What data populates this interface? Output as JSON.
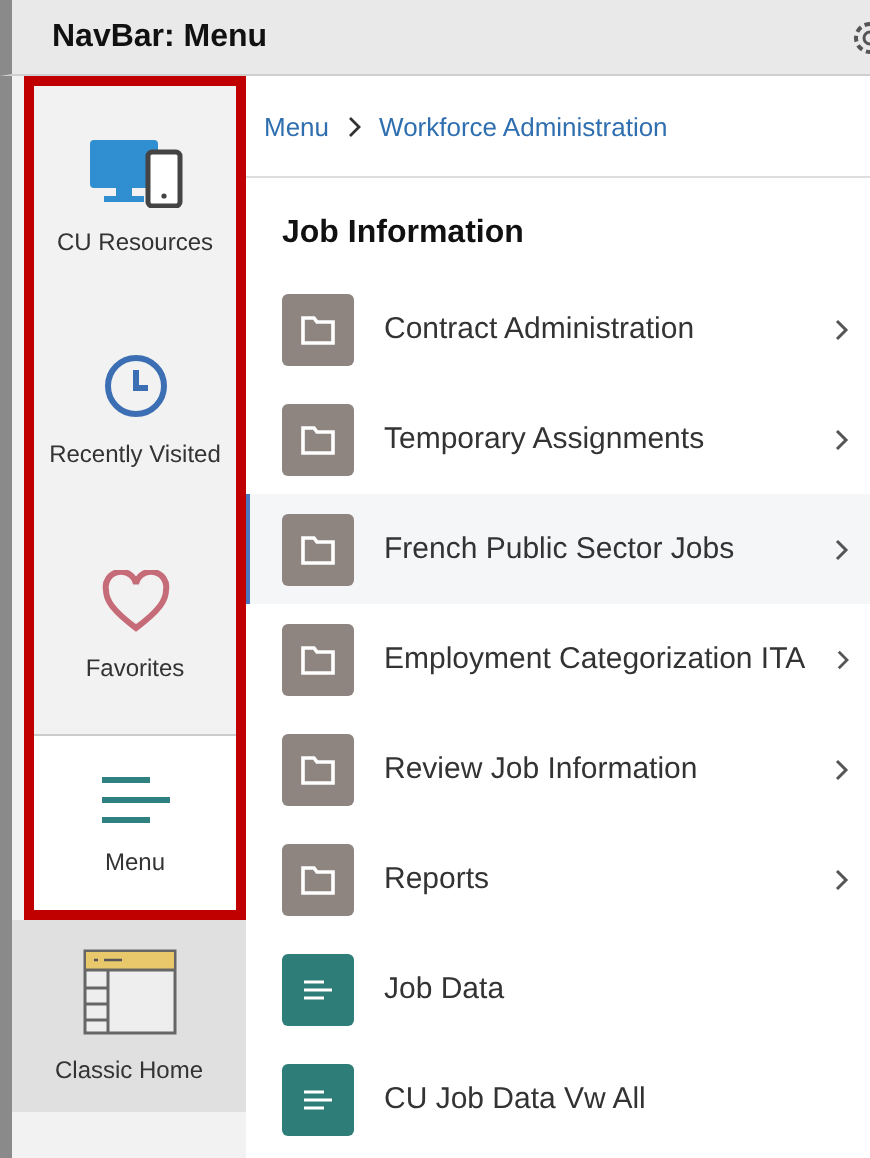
{
  "header": {
    "title": "NavBar: Menu"
  },
  "sidebar": {
    "items": [
      {
        "label": "CU Resources",
        "selected": false,
        "highlighted": true
      },
      {
        "label": "Recently Visited",
        "selected": false,
        "highlighted": true
      },
      {
        "label": "Favorites",
        "selected": false,
        "highlighted": true
      },
      {
        "label": "Menu",
        "selected": true,
        "highlighted": true
      },
      {
        "label": "Classic Home",
        "selected": false,
        "highlighted": false
      }
    ]
  },
  "breadcrumb": [
    "Menu",
    "Workforce Administration"
  ],
  "section": {
    "title": "Job Information"
  },
  "rows": [
    {
      "label": "Contract Administration",
      "kind": "folder",
      "hovered": false
    },
    {
      "label": "Temporary Assignments",
      "kind": "folder",
      "hovered": false
    },
    {
      "label": "French Public Sector Jobs",
      "kind": "folder",
      "hovered": true
    },
    {
      "label": "Employment Categorization ITA",
      "kind": "folder",
      "hovered": false
    },
    {
      "label": "Review Job Information",
      "kind": "folder",
      "hovered": false
    },
    {
      "label": "Reports",
      "kind": "folder",
      "hovered": false
    },
    {
      "label": "Job Data",
      "kind": "component",
      "hovered": false
    },
    {
      "label": "CU Job Data Vw All",
      "kind": "component",
      "hovered": false
    }
  ]
}
